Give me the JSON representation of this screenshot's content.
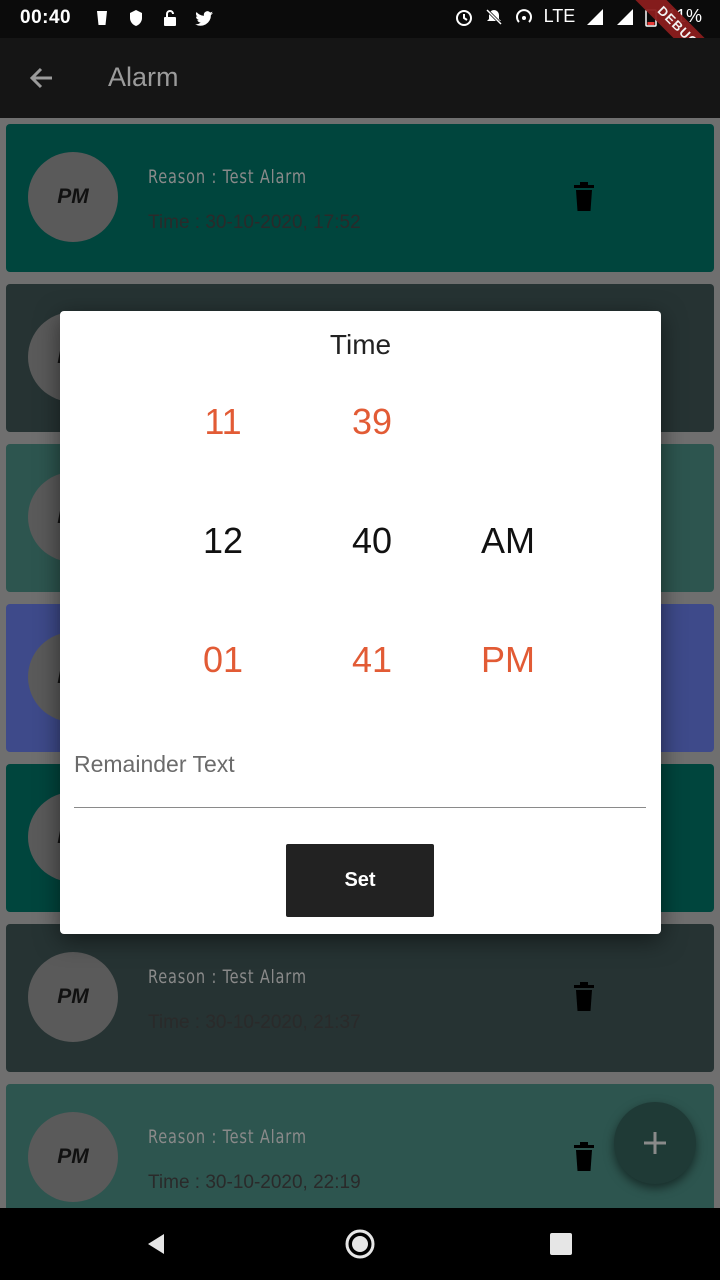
{
  "status_bar": {
    "time": "00:40",
    "network": "LTE",
    "battery": "11%",
    "debug_label": "DEBUG"
  },
  "app_bar": {
    "title": "Alarm"
  },
  "alarms": [
    {
      "avatar": "PM",
      "reason": "Reason : Test Alarm",
      "time": "Time : 30-10-2020, 17:52",
      "color": "#00453d"
    },
    {
      "avatar": "PM",
      "reason": "",
      "time": "",
      "color": "#263333"
    },
    {
      "avatar": "PM",
      "reason": "",
      "time": "",
      "color": "#2d554f"
    },
    {
      "avatar": "PM",
      "reason": "",
      "time": "",
      "color": "#3e4a8a"
    },
    {
      "avatar": "PM",
      "reason": "",
      "time": "",
      "color": "#00453d"
    },
    {
      "avatar": "PM",
      "reason": "Reason : Test Alarm",
      "time": "Time : 30-10-2020, 21:37",
      "color": "#263333"
    },
    {
      "avatar": "PM",
      "reason": "Reason : Test Alarm",
      "time": "Time : 30-10-2020, 22:19",
      "color": "#2d554f"
    }
  ],
  "dialog": {
    "title": "Time",
    "hours": {
      "prev": "11",
      "selected": "12",
      "next": "01"
    },
    "minutes": {
      "prev": "39",
      "selected": "40",
      "next": "41"
    },
    "period": {
      "selected": "AM",
      "next": "PM"
    },
    "remainder_placeholder": "Remainder Text",
    "set_label": "Set",
    "accent_color": "#e25b35"
  },
  "fab": {
    "icon": "plus-icon"
  }
}
